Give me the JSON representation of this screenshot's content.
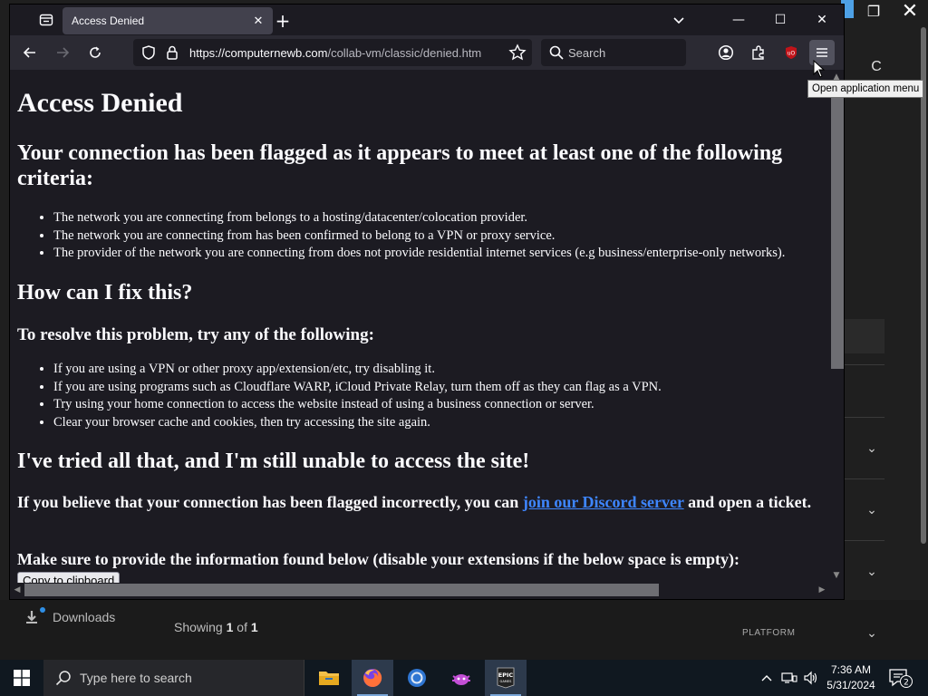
{
  "browser": {
    "tab_title": "Access Denied",
    "url_host": "https://computernewb.com",
    "url_path": "/collab-vm/classic/denied.htm",
    "search_placeholder": "Search",
    "menu_tooltip": "Open application menu",
    "accent_color": "#52525e"
  },
  "page": {
    "heading": "Access Denied",
    "flagged_heading": "Your connection has been flagged as it appears to meet at least one of the following criteria:",
    "criteria": [
      "The network you are connecting from belongs to a hosting/datacenter/colocation provider.",
      "The network you are connecting from has been confirmed to belong to a VPN or proxy service.",
      "The provider of the network you are connecting from does not provide residential internet services (e.g business/enterprise-only networks)."
    ],
    "fix_heading": "How can I fix this?",
    "resolve_heading": "To resolve this problem, try any of the following:",
    "fixes": [
      "If you are using a VPN or other proxy app/extension/etc, try disabling it.",
      "If you are using programs such as Cloudflare WARP, iCloud Private Relay, turn them off as they can flag as a VPN.",
      "Try using your home connection to access the website instead of using a business connection or server.",
      "Clear your browser cache and cookies, then try accessing the site again."
    ],
    "tried_heading": "I've tried all that, and I'm still unable to access the site!",
    "believe_prefix": "If you believe that your connection has been flagged incorrectly, you can ",
    "discord_link": "join our Discord server",
    "believe_suffix": " and open a ticket.",
    "provide_info": "Make sure to provide the information found below (disable your extensions if the below space is empty):",
    "copy_button": "Copy to clipboard",
    "link_color": "#3e86ff"
  },
  "background_app": {
    "avatar_letter": "C",
    "downloads_label": "Downloads",
    "showing_prefix": "Showing ",
    "showing_current": "1",
    "showing_of": " of ",
    "showing_total": "1",
    "platform_label": "PLATFORM"
  },
  "taskbar": {
    "search_placeholder": "Type here to search",
    "time": "7:36 AM",
    "date": "5/31/2024",
    "notification_count": "2",
    "apps": [
      "file-explorer-icon",
      "firefox-icon",
      "chrome-icon",
      "pink-app-icon",
      "epic-games-icon"
    ]
  }
}
